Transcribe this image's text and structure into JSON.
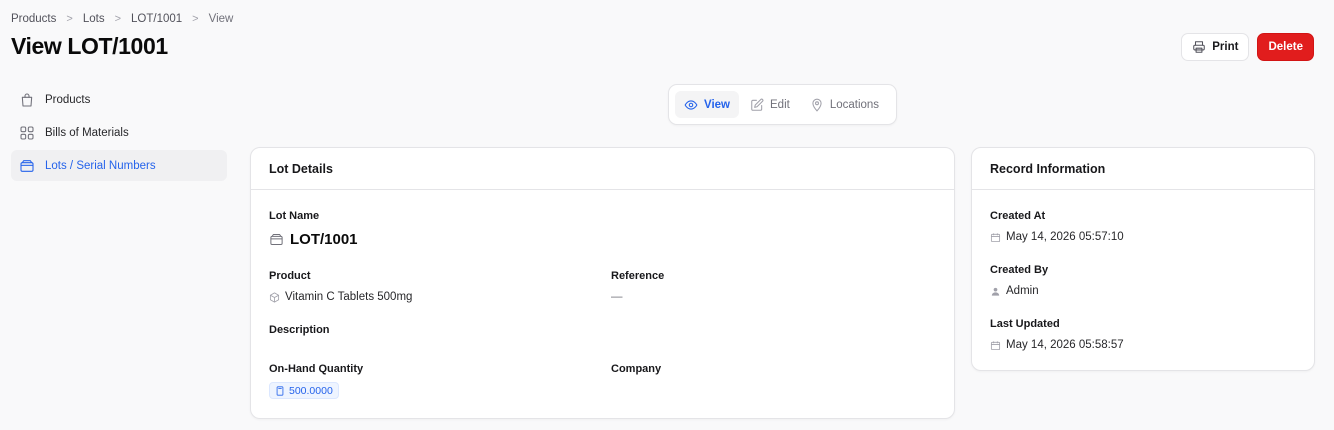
{
  "breadcrumb": {
    "items": [
      "Products",
      "Lots",
      "LOT/1001",
      "View"
    ],
    "separator": ">"
  },
  "page": {
    "title": "View LOT/1001"
  },
  "actions": {
    "print_label": "Print",
    "delete_label": "Delete",
    "delete_color": "#e11d1d"
  },
  "sidebar": {
    "items": [
      {
        "label": "Products",
        "icon": "shopping-bag-icon"
      },
      {
        "label": "Bills of Materials",
        "icon": "grid-icon"
      },
      {
        "label": "Lots / Serial Numbers",
        "icon": "box-icon",
        "active": true
      }
    ]
  },
  "tabs": [
    {
      "label": "View",
      "icon": "eye-icon",
      "active": true
    },
    {
      "label": "Edit",
      "icon": "edit-icon"
    },
    {
      "label": "Locations",
      "icon": "map-pin-icon"
    }
  ],
  "lot_details": {
    "title": "Lot Details",
    "lot_name_label": "Lot Name",
    "lot_name_value": "LOT/1001",
    "product_label": "Product",
    "product_value": "Vitamin C Tablets 500mg",
    "reference_label": "Reference",
    "reference_value": "—",
    "description_label": "Description",
    "quantity_label": "On-Hand Quantity",
    "quantity_value": "500.0000",
    "company_label": "Company"
  },
  "record_info": {
    "title": "Record Information",
    "created_at_label": "Created At",
    "created_at_value": "May 14, 2026 05:57:10",
    "created_by_label": "Created By",
    "created_by_value": "Admin",
    "updated_label": "Last Updated",
    "updated_value": "May 14, 2026 05:58:57"
  },
  "colors": {
    "accent": "#2563eb",
    "background": "#f9f9fa",
    "active_nav_bg": "#f0f0f2"
  }
}
